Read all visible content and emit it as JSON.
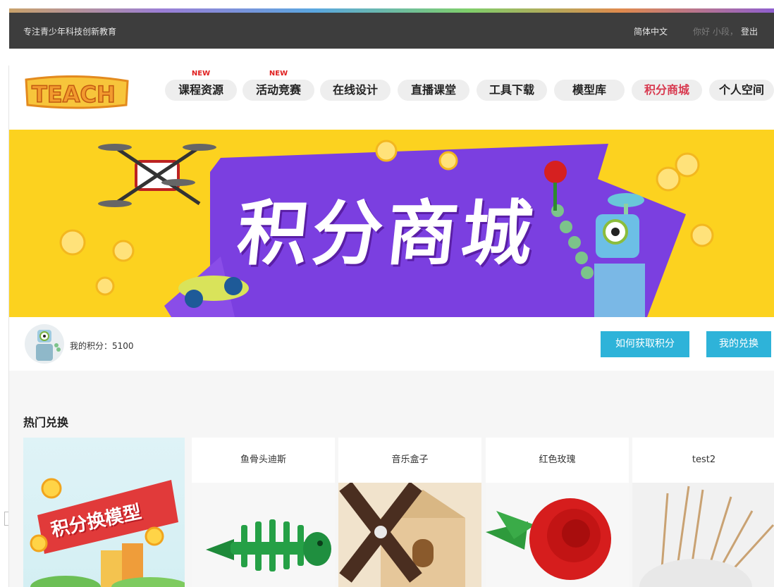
{
  "topbar": {
    "slogan": "专注青少年科技创新教育",
    "language": "简体中文",
    "greeting": "你好 小段，",
    "logout": "登出"
  },
  "header": {
    "logo_text": "TEACH",
    "nav": [
      {
        "label": "课程资源",
        "badge": "NEW"
      },
      {
        "label": "活动竞赛",
        "badge": "NEW"
      },
      {
        "label": "在线设计"
      },
      {
        "label": "直播课堂"
      },
      {
        "label": "工具下载"
      },
      {
        "label": "模型库"
      },
      {
        "label": "积分商城",
        "active": true
      },
      {
        "label": "个人空间"
      }
    ]
  },
  "banner": {
    "title": "积分商城"
  },
  "user": {
    "points_text": "我的积分：5100",
    "how_to_earn": "如何获取积分",
    "my_exchange": "我的兑换"
  },
  "hot": {
    "title": "热门兑换",
    "promo_text": "积分换模型",
    "products": [
      {
        "name": "鱼骨头迪斯"
      },
      {
        "name": "音乐盒子"
      },
      {
        "name": "红色玫瑰"
      },
      {
        "name": "test2"
      }
    ]
  },
  "colors": {
    "topbar_bg": "#3d3d3d",
    "banner_bg": "#fcd21f",
    "banner_purple": "#7b3fe0",
    "button_blue": "#2eb3d9",
    "active_nav": "#d8394f",
    "new_badge": "#e02020"
  }
}
